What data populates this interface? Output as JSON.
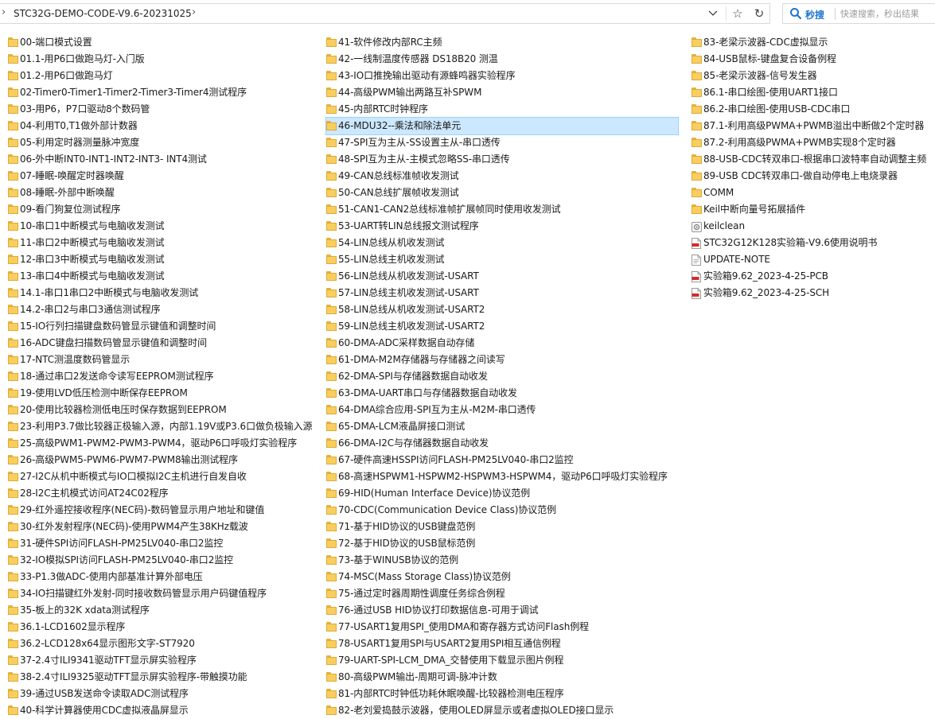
{
  "address_bar": {
    "path": "STC32G-DEMO-CODE-V9.6-20231025"
  },
  "search": {
    "button_label": "秒搜",
    "placeholder": "快速搜索，秒出结果"
  },
  "columns": [
    {
      "items": [
        {
          "name": "00-端口模式设置",
          "type": "folder"
        },
        {
          "name": "01.1-用P6口做跑马灯-入门版",
          "type": "folder"
        },
        {
          "name": "01.2-用P6口做跑马灯",
          "type": "folder"
        },
        {
          "name": "02-Timer0-Timer1-Timer2-Timer3-Timer4测试程序",
          "type": "folder"
        },
        {
          "name": "03-用P6，P7口驱动8个数码管",
          "type": "folder"
        },
        {
          "name": "04-利用T0,T1做外部计数器",
          "type": "folder"
        },
        {
          "name": "05-利用定时器测量脉冲宽度",
          "type": "folder"
        },
        {
          "name": "06-外中断INT0-INT1-INT2-INT3- INT4测试",
          "type": "folder"
        },
        {
          "name": "07-睡眠-唤醒定时器唤醒",
          "type": "folder"
        },
        {
          "name": "08-睡眠-外部中断唤醒",
          "type": "folder"
        },
        {
          "name": "09-看门狗复位测试程序",
          "type": "folder"
        },
        {
          "name": "10-串口1中断模式与电脑收发测试",
          "type": "folder"
        },
        {
          "name": "11-串口2中断模式与电脑收发测试",
          "type": "folder"
        },
        {
          "name": "12-串口3中断模式与电脑收发测试",
          "type": "folder"
        },
        {
          "name": "13-串口4中断模式与电脑收发测试",
          "type": "folder"
        },
        {
          "name": "14.1-串口1串口2中断模式与电脑收发测试",
          "type": "folder"
        },
        {
          "name": "14.2-串口2与串口3通信测试程序",
          "type": "folder"
        },
        {
          "name": "15-IO行列扫描键盘数码管显示键值和调整时间",
          "type": "folder"
        },
        {
          "name": "16-ADC键盘扫描数码管显示键值和调整时间",
          "type": "folder"
        },
        {
          "name": "17-NTC测温度数码管显示",
          "type": "folder"
        },
        {
          "name": "18-通过串口2发送命令读写EEPROM测试程序",
          "type": "folder"
        },
        {
          "name": "19-使用LVD低压检测中断保存EEPROM",
          "type": "folder"
        },
        {
          "name": "20-使用比较器检测低电压时保存数据到EEPROM",
          "type": "folder"
        },
        {
          "name": "23-利用P3.7做比较器正极输入源，内部1.19V或P3.6口做负极输入源",
          "type": "folder"
        },
        {
          "name": "25-高级PWM1-PWM2-PWM3-PWM4，驱动P6口呼吸灯实验程序",
          "type": "folder"
        },
        {
          "name": "26-高级PWM5-PWM6-PWM7-PWM8输出测试程序",
          "type": "folder"
        },
        {
          "name": "27-I2C从机中断模式与IO口模拟I2C主机进行自发自收",
          "type": "folder"
        },
        {
          "name": "28-I2C主机模式访问AT24C02程序",
          "type": "folder"
        },
        {
          "name": "29-红外遥控接收程序(NEC码)-数码管显示用户地址和键值",
          "type": "folder"
        },
        {
          "name": "30-红外发射程序(NEC码)-使用PWM4产生38KHz载波",
          "type": "folder"
        },
        {
          "name": "31-硬件SPI访问FLASH-PM25LV040-串口2监控",
          "type": "folder"
        },
        {
          "name": "32-IO模拟SPI访问FLASH-PM25LV040-串口2监控",
          "type": "folder"
        },
        {
          "name": "33-P1.3做ADC-使用内部基准计算外部电压",
          "type": "folder"
        },
        {
          "name": "34-IO扫描键红外发射-同时接收数码管显示用户码键值程序",
          "type": "folder"
        },
        {
          "name": "35-板上的32K xdata测试程序",
          "type": "folder"
        },
        {
          "name": "36.1-LCD1602显示程序",
          "type": "folder"
        },
        {
          "name": "36.2-LCD128x64显示图形文字-ST7920",
          "type": "folder"
        },
        {
          "name": "37-2.4寸ILI9341驱动TFT显示屏实验程序",
          "type": "folder"
        },
        {
          "name": "38-2.4寸ILI9325驱动TFT显示屏实验程序-带触摸功能",
          "type": "folder"
        },
        {
          "name": "39-通过USB发送命令读取ADC测试程序",
          "type": "folder"
        },
        {
          "name": "40-科学计算器使用CDC虚拟液晶屏显示",
          "type": "folder"
        }
      ]
    },
    {
      "items": [
        {
          "name": "41-软件修改内部RC主频",
          "type": "folder"
        },
        {
          "name": "42-一线制温度传感器 DS18B20 测温",
          "type": "folder"
        },
        {
          "name": "43-IO口推挽输出驱动有源蜂鸣器实验程序",
          "type": "folder"
        },
        {
          "name": "44-高级PWM输出两路互补SPWM",
          "type": "folder"
        },
        {
          "name": "45-内部RTC时钟程序",
          "type": "folder"
        },
        {
          "name": "46-MDU32--乘法和除法单元",
          "type": "folder",
          "selected": true
        },
        {
          "name": "47-SPI互为主从-SS设置主从-串口透传",
          "type": "folder"
        },
        {
          "name": "48-SPI互为主从-主模式忽略SS-串口透传",
          "type": "folder"
        },
        {
          "name": "49-CAN总线标准帧收发测试",
          "type": "folder"
        },
        {
          "name": "50-CAN总线扩展帧收发测试",
          "type": "folder"
        },
        {
          "name": "51-CAN1-CAN2总线标准帧扩展帧同时使用收发测试",
          "type": "folder"
        },
        {
          "name": "53-UART转LIN总线报文测试程序",
          "type": "folder"
        },
        {
          "name": "54-LIN总线从机收发测试",
          "type": "folder"
        },
        {
          "name": "55-LIN总线主机收发测试",
          "type": "folder"
        },
        {
          "name": "56-LIN总线从机收发测试-USART",
          "type": "folder"
        },
        {
          "name": "57-LIN总线主机收发测试-USART",
          "type": "folder"
        },
        {
          "name": "58-LIN总线从机收发测试-USART2",
          "type": "folder"
        },
        {
          "name": "59-LIN总线主机收发测试-USART2",
          "type": "folder"
        },
        {
          "name": "60-DMA-ADC采样数据自动存储",
          "type": "folder"
        },
        {
          "name": "61-DMA-M2M存储器与存储器之间读写",
          "type": "folder"
        },
        {
          "name": "62-DMA-SPI与存储器数据自动收发",
          "type": "folder"
        },
        {
          "name": "63-DMA-UART串口与存储器数据自动收发",
          "type": "folder"
        },
        {
          "name": "64-DMA综合应用-SPI互为主从-M2M-串口透传",
          "type": "folder"
        },
        {
          "name": "65-DMA-LCM液晶屏接口测试",
          "type": "folder"
        },
        {
          "name": "66-DMA-I2C与存储器数据自动收发",
          "type": "folder"
        },
        {
          "name": "67-硬件高速HSSPI访问FLASH-PM25LV040-串口2监控",
          "type": "folder"
        },
        {
          "name": "68-高速HSPWM1-HSPWM2-HSPWM3-HSPWM4，驱动P6口呼吸灯实验程序",
          "type": "folder"
        },
        {
          "name": "69-HID(Human Interface Device)协议范例",
          "type": "folder"
        },
        {
          "name": "70-CDC(Communication Device Class)协议范例",
          "type": "folder"
        },
        {
          "name": "71-基于HID协议的USB键盘范例",
          "type": "folder"
        },
        {
          "name": "72-基于HID协议的USB鼠标范例",
          "type": "folder"
        },
        {
          "name": "73-基于WINUSB协议的范例",
          "type": "folder"
        },
        {
          "name": "74-MSC(Mass Storage Class)协议范例",
          "type": "folder"
        },
        {
          "name": "75-通过定时器周期性调度任务综合例程",
          "type": "folder"
        },
        {
          "name": "76-通过USB HID协议打印数据信息-可用于调试",
          "type": "folder"
        },
        {
          "name": "77-USART1复用SPI_使用DMA和寄存器方式访问Flash例程",
          "type": "folder"
        },
        {
          "name": "78-USART1复用SPI与USART2复用SPI相互通信例程",
          "type": "folder"
        },
        {
          "name": "79-UART-SPI-LCM_DMA_交替使用下载显示图片例程",
          "type": "folder"
        },
        {
          "name": "80-高级PWM输出-周期可调-脉冲计数",
          "type": "folder"
        },
        {
          "name": "81-内部RTC时钟低功耗休眠唤醒-比较器检测电压程序",
          "type": "folder"
        },
        {
          "name": "82-老刘爱捣鼓示波器，使用OLED屏显示或者虚拟OLED接口显示",
          "type": "folder"
        }
      ]
    },
    {
      "items": [
        {
          "name": "83-老梁示波器-CDC虚拟显示",
          "type": "folder"
        },
        {
          "name": "84-USB鼠标-键盘复合设备例程",
          "type": "folder"
        },
        {
          "name": "85-老梁示波器-信号发生器",
          "type": "folder"
        },
        {
          "name": "86.1-串口绘图-使用UART1接口",
          "type": "folder"
        },
        {
          "name": "86.2-串口绘图-使用USB-CDC串口",
          "type": "folder"
        },
        {
          "name": "87.1-利用高级PWMA+PWMB溢出中断做2个定时器",
          "type": "folder"
        },
        {
          "name": "87.2-利用高级PWMA+PWMB实现8个定时器",
          "type": "folder"
        },
        {
          "name": "88-USB-CDC转双串口-根据串口波特率自动调整主频",
          "type": "folder"
        },
        {
          "name": "89-USB CDC转双串口-做自动停电上电烧录器",
          "type": "folder"
        },
        {
          "name": "COMM",
          "type": "folder"
        },
        {
          "name": "Keil中断向量号拓展插件",
          "type": "folder"
        },
        {
          "name": "keilclean",
          "type": "exe"
        },
        {
          "name": "STC32G12K128实验箱-V9.6使用说明书",
          "type": "pdf"
        },
        {
          "name": "UPDATE-NOTE",
          "type": "txt"
        },
        {
          "name": "实验箱9.62_2023-4-25-PCB",
          "type": "pdf"
        },
        {
          "name": "实验箱9.62_2023-4-25-SCH",
          "type": "pdf"
        }
      ]
    }
  ]
}
